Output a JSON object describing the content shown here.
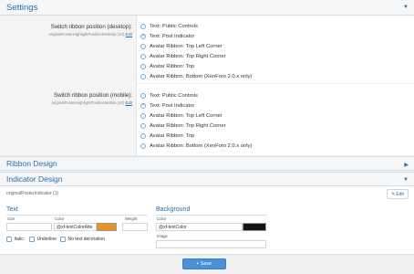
{
  "settings": {
    "title": "Settings",
    "desktop": {
      "label": "Switch ribbon position (desktop):",
      "sub": "originalPosterHighlightPositionDesktop (10)",
      "edit": "Edit",
      "options": [
        "Text: Public Controls",
        "Text: Post Indicator",
        "Avatar Ribbon: Top Left Corner",
        "Avatar Ribbon: Top Right Corner",
        "Avatar Ribbon: Top",
        "Avatar Ribbon: Bottom (XenForo 2.0.x only)"
      ],
      "selected_index": 1
    },
    "mobile": {
      "label": "Switch ribbon position (mobile):",
      "sub": "originalPosterHighlightPositionMobile (20)",
      "edit": "Edit",
      "options": [
        "Text: Public Controls",
        "Text: Post Indicator",
        "Avatar Ribbon: Top Left Corner",
        "Avatar Ribbon: Top Right Corner",
        "Avatar Ribbon: Top",
        "Avatar Ribbon: Bottom (XenForo 2.0.x only)"
      ],
      "selected_index": 1
    }
  },
  "ribbon_design": {
    "title": "Ribbon Design"
  },
  "indicator_design": {
    "title": "Indicator Design",
    "name": "originalPosterIndicator (1)",
    "edit_label": "Edit",
    "text": {
      "title": "Text",
      "size_label": "Size",
      "size_value": "",
      "color_label": "Color",
      "color_value": "@xf-textColorAtte",
      "weight_label": "Weight",
      "weight_value": "",
      "swatch_color": "#e8922a",
      "italic": "Italic",
      "underline": "Underline",
      "no_decoration": "No text decoration"
    },
    "background": {
      "title": "Background",
      "color_label": "Color",
      "color_value": "@xf-textColor",
      "swatch_color": "#141414",
      "image_label": "Image",
      "image_value": ""
    }
  },
  "save": {
    "label": "Save"
  },
  "colors": {
    "accent": "#2b6ea6",
    "button": "#4a90d6"
  }
}
